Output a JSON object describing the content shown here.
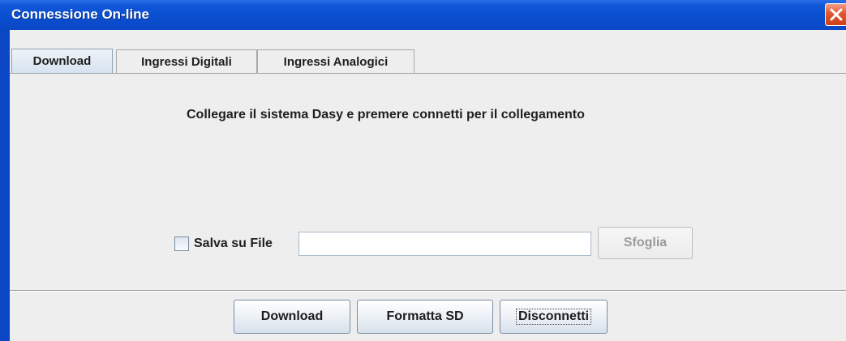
{
  "window": {
    "title": "Connessione On-line",
    "close_icon": "close-icon"
  },
  "tabs": [
    {
      "label": "Download",
      "selected": true
    },
    {
      "label": "Ingressi Digitali",
      "selected": false
    },
    {
      "label": "Ingressi Analogici",
      "selected": false
    }
  ],
  "download": {
    "message": "Collegare il sistema Dasy e premere connetti per il collegamento",
    "save_to_file": {
      "label": "Salva su File",
      "checked": false
    },
    "file_path": {
      "value": "",
      "placeholder": ""
    },
    "browse_label": "Sfoglia"
  },
  "actions": {
    "download_label": "Download",
    "format_label": "Formatta SD",
    "disconnect_label": "Disconnetti"
  },
  "colors": {
    "titlebar": "#0b47c4",
    "close_button": "#e0572f",
    "background": "#eeeeee"
  }
}
